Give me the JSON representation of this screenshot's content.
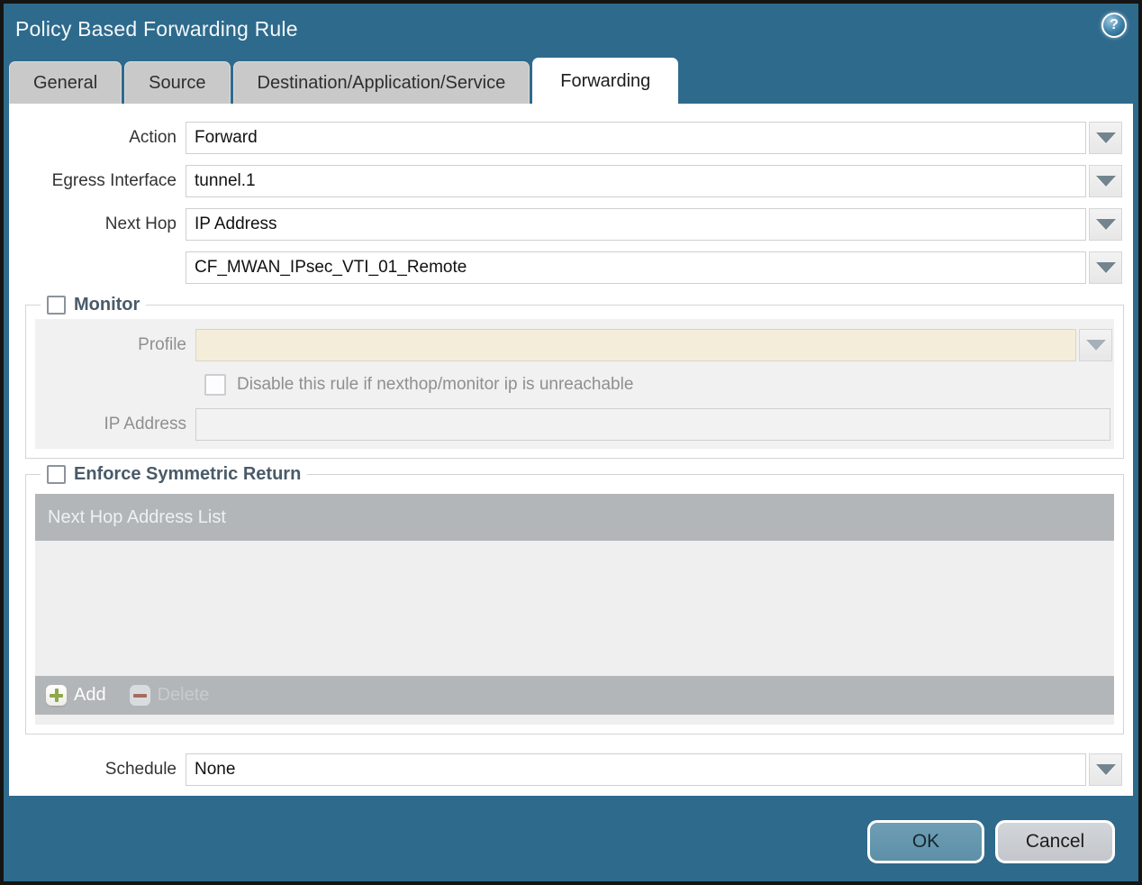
{
  "dialog": {
    "title": "Policy Based Forwarding Rule"
  },
  "icons": {
    "help": "?"
  },
  "tabs": [
    {
      "label": "General",
      "active": false
    },
    {
      "label": "Source",
      "active": false
    },
    {
      "label": "Destination/Application/Service",
      "active": false
    },
    {
      "label": "Forwarding",
      "active": true
    }
  ],
  "form": {
    "action": {
      "label": "Action",
      "value": "Forward"
    },
    "egress_interface": {
      "label": "Egress Interface",
      "value": "tunnel.1"
    },
    "next_hop": {
      "label": "Next Hop",
      "value": "IP Address"
    },
    "next_hop_address": {
      "value": "CF_MWAN_IPsec_VTI_01_Remote"
    },
    "schedule": {
      "label": "Schedule",
      "value": "None"
    }
  },
  "monitor": {
    "legend": "Monitor",
    "checked": false,
    "profile_label": "Profile",
    "profile_value": "",
    "disable_rule_label": "Disable this rule if nexthop/monitor ip is unreachable",
    "disable_rule_checked": false,
    "ip_address_label": "IP Address",
    "ip_address_value": ""
  },
  "symmetric_return": {
    "legend": "Enforce Symmetric Return",
    "checked": false,
    "table_header": "Next Hop Address List",
    "rows": [],
    "add_label": "Add",
    "delete_label": "Delete",
    "delete_enabled": false
  },
  "footer": {
    "ok_label": "OK",
    "cancel_label": "Cancel"
  },
  "colors": {
    "accent_teal": "#2e6a8c",
    "tab_inactive": "#c9c9c9",
    "table_bar": "#b2b6b9",
    "disabled_field_cream": "#f3edda",
    "ok_button": "#6497ae",
    "cancel_button": "#c9cdd1",
    "add_plus_green": "#8fa94a",
    "delete_minus_red": "#a96a5e"
  }
}
